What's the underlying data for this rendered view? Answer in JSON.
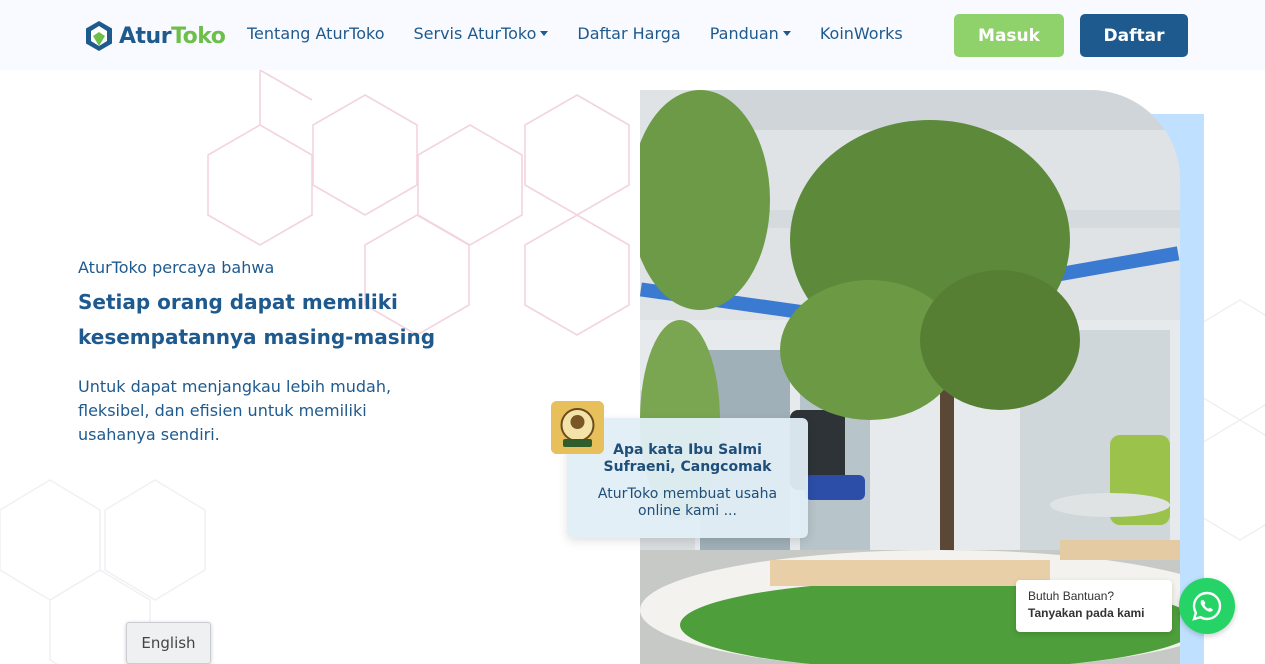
{
  "brand": {
    "name_part1": "Atur",
    "name_part2": "Toko",
    "color_primary": "#1f5a8e",
    "color_accent": "#6cc04a"
  },
  "nav": {
    "items": [
      {
        "label": "Tentang AturToko",
        "dropdown": false
      },
      {
        "label": "Servis AturToko",
        "dropdown": true
      },
      {
        "label": "Daftar Harga",
        "dropdown": false
      },
      {
        "label": "Panduan",
        "dropdown": true
      },
      {
        "label": "KoinWorks",
        "dropdown": false
      }
    ],
    "login_label": "Masuk",
    "register_label": "Daftar"
  },
  "hero": {
    "kicker": "AturToko percaya bahwa",
    "title": "Setiap orang dapat memiliki kesempatannya masing-masing",
    "subtitle": "Untuk dapat menjangkau lebih mudah, fleksibel, dan efisien untuk memiliki usahanya sendiri."
  },
  "testimonial": {
    "title": "Apa kata Ibu Salmi Sufraeni, Cangcomak",
    "quote": "AturToko membuat usaha online kami ...",
    "logo_icon": "cangcomak-logo"
  },
  "help": {
    "title": "Butuh Bantuan?",
    "subtitle": "Tanyakan pada kami",
    "whatsapp_icon": "whatsapp-icon",
    "whatsapp_color": "#25d366"
  },
  "language": {
    "label": "English"
  }
}
